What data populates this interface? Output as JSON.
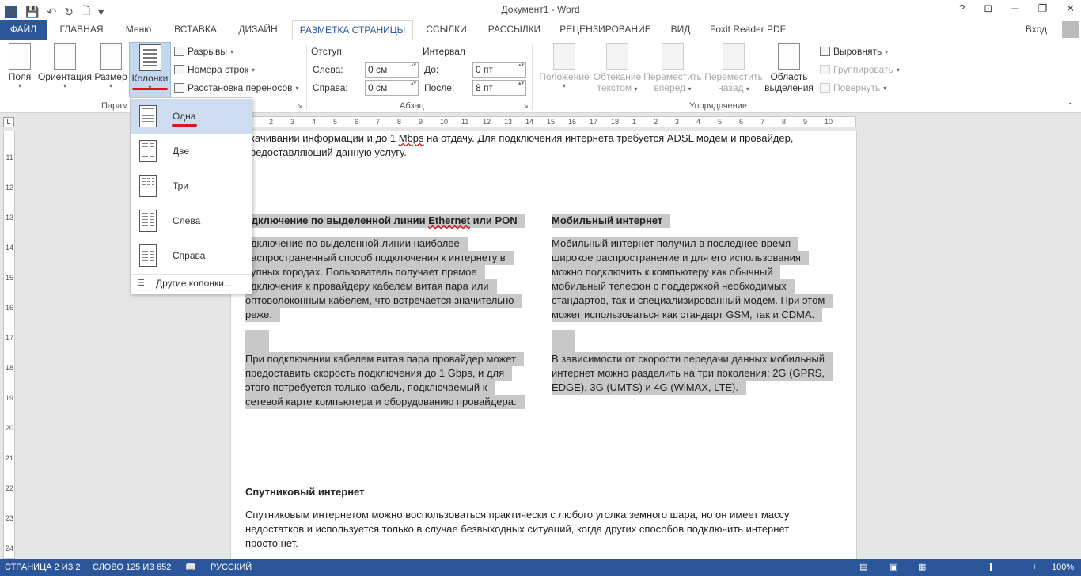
{
  "window": {
    "title": "Документ1 - Word",
    "help": "?",
    "user": "Вход"
  },
  "qat_icons": [
    "word-icon",
    "save-icon",
    "undo-icon",
    "redo-icon",
    "new-doc-icon",
    "customize-icon"
  ],
  "tabs": [
    {
      "label": "ФАЙЛ"
    },
    {
      "label": "ГЛАВНАЯ"
    },
    {
      "label": "Меню"
    },
    {
      "label": "ВСТАВКА"
    },
    {
      "label": "ДИЗАЙН"
    },
    {
      "label": "РАЗМЕТКА СТРАНИЦЫ"
    },
    {
      "label": "ССЫЛКИ"
    },
    {
      "label": "РАССЫЛКИ"
    },
    {
      "label": "РЕЦЕНЗИРОВАНИЕ"
    },
    {
      "label": "ВИД"
    },
    {
      "label": "Foxit Reader PDF"
    }
  ],
  "ribbon": {
    "margins": "Поля",
    "orientation": "Ориентация",
    "size": "Размер",
    "columns": "Колонки",
    "breaks": "Разрывы",
    "line_numbers": "Номера строк",
    "hyphenation": "Расстановка переносов",
    "group_page_setup": "Парам",
    "indent_title": "Отступ",
    "indent_left_label": "Слева:",
    "indent_left": "0 см",
    "indent_right_label": "Справа:",
    "indent_right": "0 см",
    "spacing_title": "Интервал",
    "spacing_before_label": "До:",
    "spacing_before": "0 пт",
    "spacing_after_label": "После:",
    "spacing_after": "8 пт",
    "group_paragraph": "Абзац",
    "position": "Положение",
    "wrap_1": "Обтекание",
    "wrap_2": "текстом",
    "forward_1": "Переместить",
    "forward_2": "вперед",
    "backward_1": "Переместить",
    "backward_2": "назад",
    "selection_1": "Область",
    "selection_2": "выделения",
    "align": "Выровнять",
    "group": "Группировать",
    "rotate": "Повернуть",
    "group_arrange": "Упорядочение"
  },
  "columns_menu": {
    "items": [
      "Одна",
      "Две",
      "Три",
      "Слева",
      "Справа"
    ],
    "more": "Другие колонки..."
  },
  "doc": {
    "p1_l1": "качивании информации и до 1 ",
    "p1_mbps": "Mbps",
    "p1_l1b": " на отдачу. Для подключения интернета требуется ADSL модем и провайдер,",
    "p1_l2": "редоставляющий данную услугу.",
    "left_head_a": "одключение по выделенной линии ",
    "left_head_eth": "Ethernet",
    "left_head_b": " или PON",
    "left_p1": [
      "одключение по выделенной линии наиболее",
      "распространенный способ подключения к интернету в",
      "рупных городах. Пользователь получает прямое",
      "одключения к провайдеру кабелем витая пара или",
      "оптоволоконным кабелем, что встречается значительно",
      "реже."
    ],
    "left_p2": [
      "При подключении кабелем витая пара провайдер может",
      "предоставить скорость подключения до 1 Gbps, и для",
      "этого потребуется только кабель, подключаемый к",
      "сетевой карте компьютера и оборудованию провайдера."
    ],
    "right_head": "Мобильный интернет",
    "right_p1": [
      "Мобильный интернет получил в последнее время",
      "широкое распространение и для его использования",
      "можно подключить к компьютеру как обычный",
      "мобильный телефон с поддержкой необходимых",
      "стандартов, так и специализированный модем. При этом",
      "может использоваться как стандарт GSM, так и CDMA."
    ],
    "right_p2": [
      "В зависимости от скорости передачи данных мобильный",
      "интернет можно разделить на три поколения: 2G (GPRS,",
      "EDGE), 3G (UMTS) и 4G (WiMAX, LTE)."
    ],
    "sat_head": "Спутниковый интернет",
    "sat_p": [
      "Спутниковым интернетом можно воспользоваться практически с любого уголка земного шара, но он имеет массу",
      "недостатков и используется только в случае безвыходных ситуаций, когда других способов подключить интернет",
      "просто нет."
    ]
  },
  "hruler_nums": [
    "1",
    "2",
    "3",
    "4",
    "5",
    "6",
    "7",
    "8",
    "9",
    "10",
    "11",
    "12",
    "13",
    "14",
    "15",
    "16",
    "17",
    "18",
    "1",
    "2",
    "3",
    "4",
    "5",
    "6",
    "7",
    "8",
    "9",
    "10"
  ],
  "vruler_nums": [
    "11",
    "12",
    "13",
    "14",
    "15",
    "16",
    "17",
    "18",
    "19",
    "20",
    "21",
    "22",
    "23",
    "24"
  ],
  "status": {
    "page": "СТРАНИЦА 2 ИЗ 2",
    "words": "СЛОВО 125 ИЗ 652",
    "lang": "РУССКИЙ",
    "zoom": "100%",
    "zoom_pct": 100
  },
  "colors": {
    "accent": "#2b579a",
    "highlight": "#c8c8c8",
    "underline_red": "#e0141e"
  }
}
